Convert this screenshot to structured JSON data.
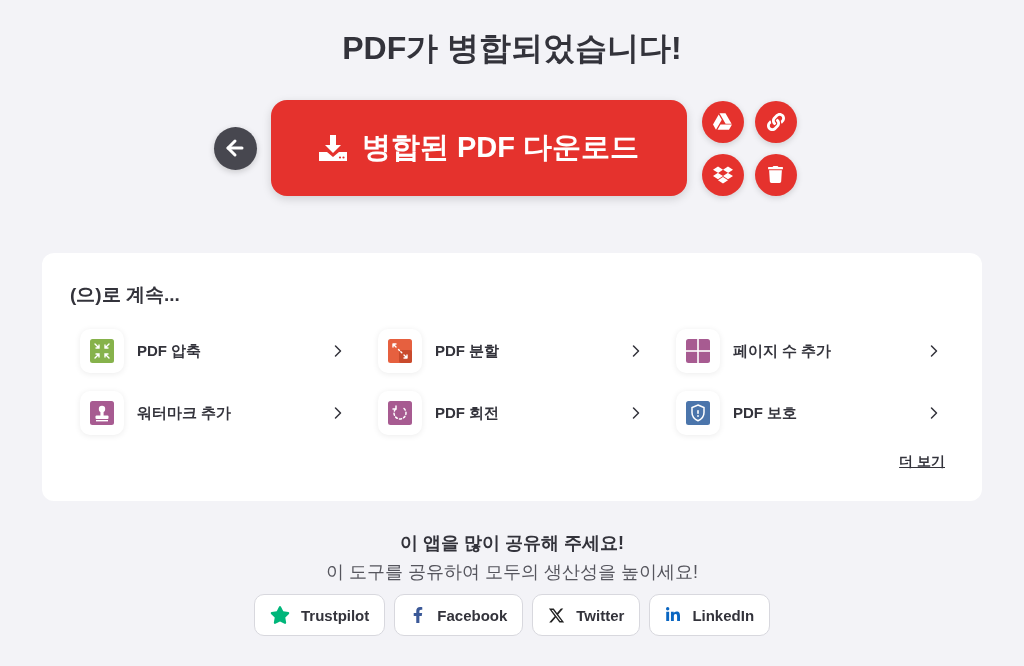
{
  "title": "PDF가 병합되었습니다!",
  "download_button": {
    "label": "병합된 PDF 다운로드"
  },
  "continue_panel": {
    "heading": "(으)로 계속...",
    "tools": [
      {
        "label": "PDF 압축",
        "kind": "compress",
        "color": "#86b24b"
      },
      {
        "label": "PDF 분할",
        "kind": "split",
        "color": "#e6603f"
      },
      {
        "label": "페이지 수 추가",
        "kind": "page_numbers",
        "color": "#a75b91"
      },
      {
        "label": "워터마크 추가",
        "kind": "watermark",
        "color": "#a75b91"
      },
      {
        "label": "PDF 회전",
        "kind": "rotate",
        "color": "#a75b91"
      },
      {
        "label": "PDF 보호",
        "kind": "protect",
        "color": "#4b75ab"
      }
    ],
    "more_link": "더 보기"
  },
  "share": {
    "heading": "이 앱을 많이 공유해 주세요!",
    "subheading": "이 도구를 공유하여 모두의 생산성을 높이세요!",
    "buttons": [
      {
        "label": "Trustpilot",
        "kind": "trustpilot"
      },
      {
        "label": "Facebook",
        "kind": "facebook"
      },
      {
        "label": "Twitter",
        "kind": "twitter"
      },
      {
        "label": "LinkedIn",
        "kind": "linkedin"
      }
    ]
  }
}
